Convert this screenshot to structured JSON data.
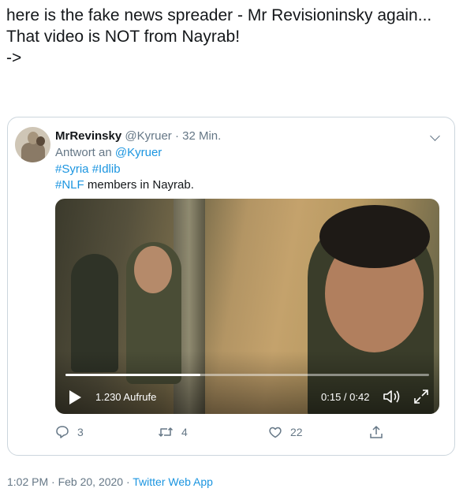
{
  "tweet": {
    "text": "here is the fake news spreader - Mr Revisioninsky again...\nThat video is NOT from Nayrab!\n->"
  },
  "quoted_tweet": {
    "display_name": "MrRevinsky",
    "handle_and_time": " @Kyruer · 32 Min.",
    "reply_prefix": "Antwort an ",
    "reply_handle": "@Kyruer",
    "hashtag_syria": "#Syria",
    "hashtag_idlib": "#Idlib",
    "hashtag_nlf": "#NLF",
    "nlf_text": " members in Nayrab.",
    "video": {
      "views": "1.230 Aufrufe",
      "time": "0:15 / 0:42",
      "progress": 0.37
    },
    "actions": {
      "replies": "3",
      "retweets": "4",
      "likes": "22"
    }
  },
  "footer": {
    "timestamp": "1:02 PM · Feb 20, 2020 · ",
    "source": "Twitter Web App"
  },
  "colors": {
    "link": "#1b95e0",
    "secondary_text": "#657786",
    "border": "#ccd6dd"
  },
  "icons": [
    "chevron-down-icon",
    "play-icon",
    "volume-icon",
    "fullscreen-icon",
    "reply-icon",
    "retweet-icon",
    "like-icon",
    "share-icon"
  ]
}
